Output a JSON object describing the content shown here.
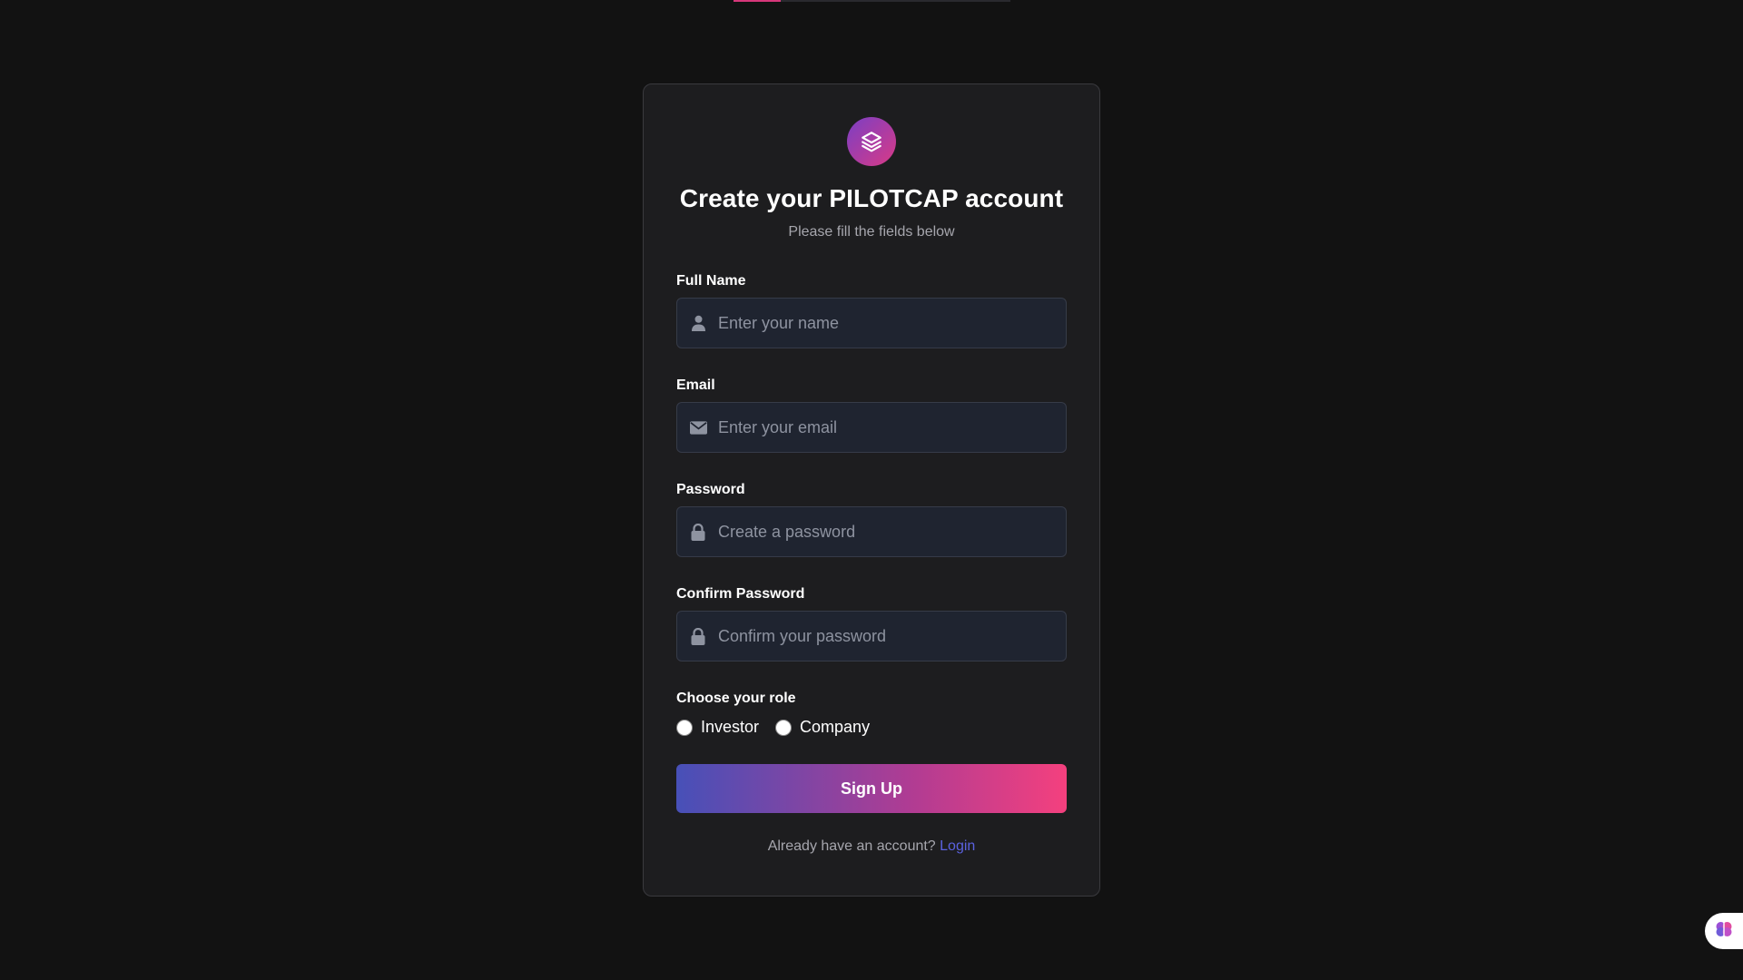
{
  "page": {
    "title": "Create your PILOTCAP account",
    "subtitle": "Please fill the fields below",
    "progress_fraction": 0.17
  },
  "form": {
    "full_name": {
      "label": "Full Name",
      "placeholder": "Enter your name",
      "value": "",
      "icon": "user-icon"
    },
    "email": {
      "label": "Email",
      "placeholder": "Enter your email",
      "value": "",
      "icon": "envelope-icon"
    },
    "password": {
      "label": "Password",
      "placeholder": "Create a password",
      "value": "",
      "icon": "lock-icon"
    },
    "confirm_password": {
      "label": "Confirm Password",
      "placeholder": "Confirm your password",
      "value": "",
      "icon": "lock-icon"
    },
    "role": {
      "label": "Choose your role",
      "options": [
        {
          "label": "Investor",
          "selected": false
        },
        {
          "label": "Company",
          "selected": false
        }
      ]
    },
    "submit_label": "Sign Up"
  },
  "footer": {
    "prompt": "Already have an account?",
    "login_label": "Login"
  },
  "colors": {
    "background": "#121212",
    "card": "#1d1d1f",
    "input_bg": "#1f2430",
    "gradient_start": "#4750b8",
    "gradient_end": "#f4407e",
    "link": "#5b62e0",
    "progress_accent": "#d6377a"
  },
  "widget": {
    "icon": "brain-icon"
  }
}
